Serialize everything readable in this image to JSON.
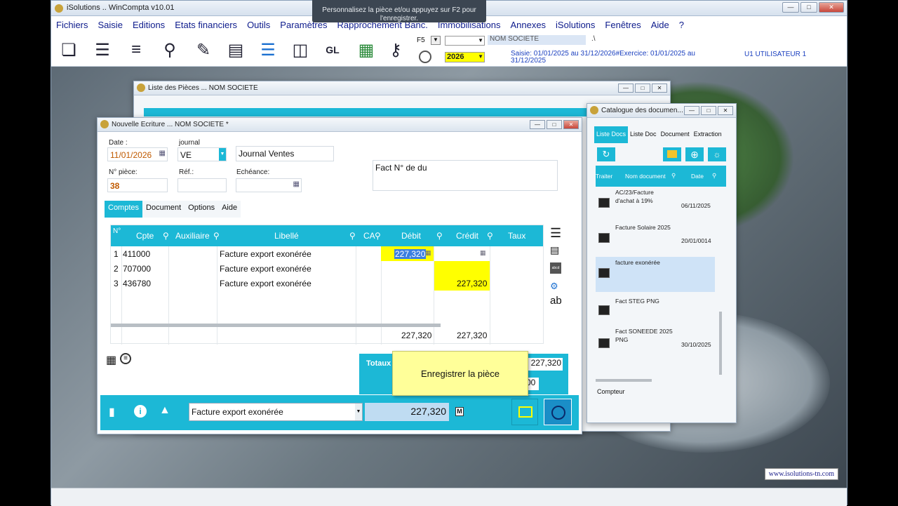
{
  "app": {
    "title": "iSolutions .. WinCompta v10.01",
    "tooltip": "Personnalisez la pièce et/ou appuyez sur F2 pour l'enregistrer.",
    "site_link": "www.isolutions-tn.com"
  },
  "menu": [
    "Fichiers",
    "Saisie",
    "Editions",
    "Etats financiers",
    "Outils",
    "Paramètres",
    "Rapprochement Banc.",
    "Immobilisations",
    "Annexes",
    "iSolutions",
    "Fenêtres",
    "Aide",
    "?"
  ],
  "toolbar": {
    "f5_label": "F5",
    "year": "2026",
    "company": "NOM SOCIETE",
    "company_suffix": ".\\",
    "saisie_info": "Saisie: 01/01/2025 au 31/12/2026#Exercice: 01/01/2025 au 31/12/2025",
    "user": "U1 UTILISATEUR 1"
  },
  "list_window": {
    "title": "Liste des Pièces ... NOM SOCIETE"
  },
  "new_entry": {
    "title": "Nouvelle Ecriture ...  NOM SOCIETE *",
    "date_label": "Date :",
    "date_value": "11/01/2026",
    "journal_label": "journal",
    "journal_code": "VE",
    "journal_name": "Journal Ventes",
    "piece_label": "N° pièce:",
    "piece_value": "38",
    "ref_label": "Réf.:",
    "echeance_label": "Echéance:",
    "note": "Fact N° de du",
    "tabs": [
      "Comptes",
      "Document",
      "Options",
      "Aide"
    ],
    "columns": [
      "N°",
      "Cpte",
      "Auxiliaire",
      "Libellé",
      "CA",
      "Débit",
      "Crédit",
      "Taux"
    ],
    "rows": [
      {
        "n": "1",
        "cpte": "411000",
        "libelle": "Facture export exonérée",
        "debit": "227,320",
        "credit": ""
      },
      {
        "n": "2",
        "cpte": "707000",
        "libelle": "Facture export exonérée",
        "debit": "",
        "credit": ""
      },
      {
        "n": "3",
        "cpte": "436780",
        "libelle": "Facture export exonérée",
        "debit": "",
        "credit": "227,320"
      }
    ],
    "total_debit": "227,320",
    "total_credit": "227,320",
    "totaux_label": "Totaux",
    "totaux_value": "227,320",
    "totaux_value2": "00",
    "side_text": "ab",
    "side_tag": "abcd",
    "bottom_libelle": "Facture export exonérée",
    "bottom_amount": "227,320",
    "m_label": "M",
    "save_tooltip": "Enregistrer la pièce"
  },
  "catalog": {
    "title": "Catalogue des documen...",
    "tabs": [
      "Liste Docs",
      "Liste Doc",
      "Document",
      "Extraction"
    ],
    "columns": [
      "Traiter",
      "Nom document",
      "Date"
    ],
    "items": [
      {
        "name": "AC/23/Facture d'achat à 19%",
        "date": "06/11/2025"
      },
      {
        "name": "Facture Solaire 2025",
        "date": "20/01/0014"
      },
      {
        "name": "facture exonérée",
        "date": ""
      },
      {
        "name": "Fact STEG PNG",
        "date": ""
      },
      {
        "name": "Fact SONEEDE 2025 PNG",
        "date": "30/10/2025"
      }
    ],
    "counter_label": "Compteur"
  }
}
